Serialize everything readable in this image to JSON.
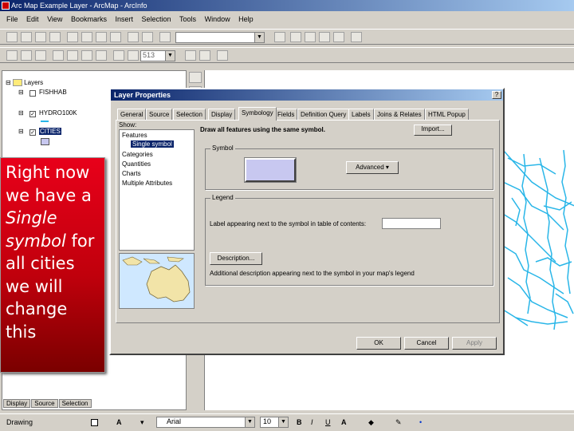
{
  "window": {
    "title": "Arc Map Example Layer - ArcMap - ArcInfo"
  },
  "menu": [
    "File",
    "Edit",
    "View",
    "Bookmarks",
    "Insert",
    "Selection",
    "Tools",
    "Window",
    "Help"
  ],
  "toolbar": {
    "scale_value": "",
    "zoom_value": "513"
  },
  "toc": {
    "root": "Layers",
    "layers": [
      {
        "name": "FISHHAB",
        "checked": false
      },
      {
        "name": "HYDRO100K",
        "checked": true
      },
      {
        "name": "CITIES",
        "checked": true
      }
    ],
    "tabs": [
      "Display",
      "Source",
      "Selection"
    ]
  },
  "dialog": {
    "title": "Layer Properties",
    "tabs": [
      "General",
      "Source",
      "Selection",
      "Display",
      "Symbology",
      "Fields",
      "Definition Query",
      "Labels",
      "Joins & Relates",
      "HTML Popup"
    ],
    "active_tab": "Symbology",
    "show_label": "Show:",
    "show_items": [
      "Features",
      "Single symbol",
      "Categories",
      "Quantities",
      "Charts",
      "Multiple Attributes"
    ],
    "heading": "Draw all features using the same symbol.",
    "import_label": "Import...",
    "symbol_group": "Symbol",
    "advanced_label": "Advanced",
    "legend_group": "Legend",
    "legend_label": "Label appearing next to the symbol in table of contents:",
    "label_value": "",
    "description_button": "Description...",
    "description_text": "Additional description appearing next to the symbol in your map's legend",
    "ok": "OK",
    "cancel": "Cancel",
    "apply": "Apply",
    "symbol_color": "#c8c8f0"
  },
  "drawing": {
    "drawing_label": "Drawing",
    "font": "Arial",
    "size": "10",
    "bold": "B",
    "italic": "I",
    "underline": "U"
  },
  "callout": {
    "line1": "Right now we have a",
    "emph": "Single symbol",
    "line2": "for all cities we will change this"
  },
  "colors": {
    "callout_bg": "#d8001a",
    "river": "#29b6e8"
  }
}
